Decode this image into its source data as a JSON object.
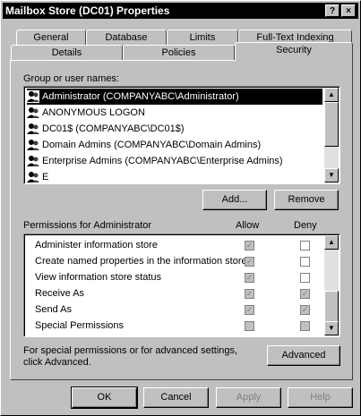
{
  "window": {
    "title": "Mailbox Store (DC01) Properties"
  },
  "titlebar_buttons": {
    "help": "?",
    "close": "×"
  },
  "tabs": {
    "row1": [
      "General",
      "Database",
      "Limits",
      "Full-Text Indexing"
    ],
    "row2": [
      "Details",
      "Policies",
      "Security"
    ],
    "active": "Security"
  },
  "users": {
    "label": "Group or user names:",
    "items": [
      "Administrator (COMPANYABC\\Administrator)",
      "ANONYMOUS LOGON",
      "DC01$ (COMPANYABC\\DC01$)",
      "Domain Admins (COMPANYABC\\Domain Admins)",
      "Enterprise Admins (COMPANYABC\\Enterprise Admins)",
      "E"
    ],
    "selected_index": 0,
    "add_label": "Add...",
    "remove_label": "Remove"
  },
  "permissions": {
    "label": "Permissions for Administrator",
    "allow_header": "Allow",
    "deny_header": "Deny",
    "items": [
      {
        "name": "Administer information store",
        "allow": true,
        "deny": false,
        "allow_grey": true,
        "deny_grey": false
      },
      {
        "name": "Create named properties in the information store",
        "allow": true,
        "deny": false,
        "allow_grey": true,
        "deny_grey": false
      },
      {
        "name": "View information store status",
        "allow": true,
        "deny": false,
        "allow_grey": true,
        "deny_grey": false
      },
      {
        "name": "Receive As",
        "allow": true,
        "deny": true,
        "allow_grey": true,
        "deny_grey": true
      },
      {
        "name": "Send As",
        "allow": true,
        "deny": true,
        "allow_grey": true,
        "deny_grey": true
      },
      {
        "name": "Special Permissions",
        "allow": false,
        "deny": false,
        "allow_grey": true,
        "deny_grey": true
      }
    ]
  },
  "advanced": {
    "text_line1": "For special permissions or for advanced settings,",
    "text_line2": "click Advanced.",
    "button_label": "Advanced"
  },
  "footer": {
    "ok": "OK",
    "cancel": "Cancel",
    "apply": "Apply",
    "help": "Help"
  }
}
